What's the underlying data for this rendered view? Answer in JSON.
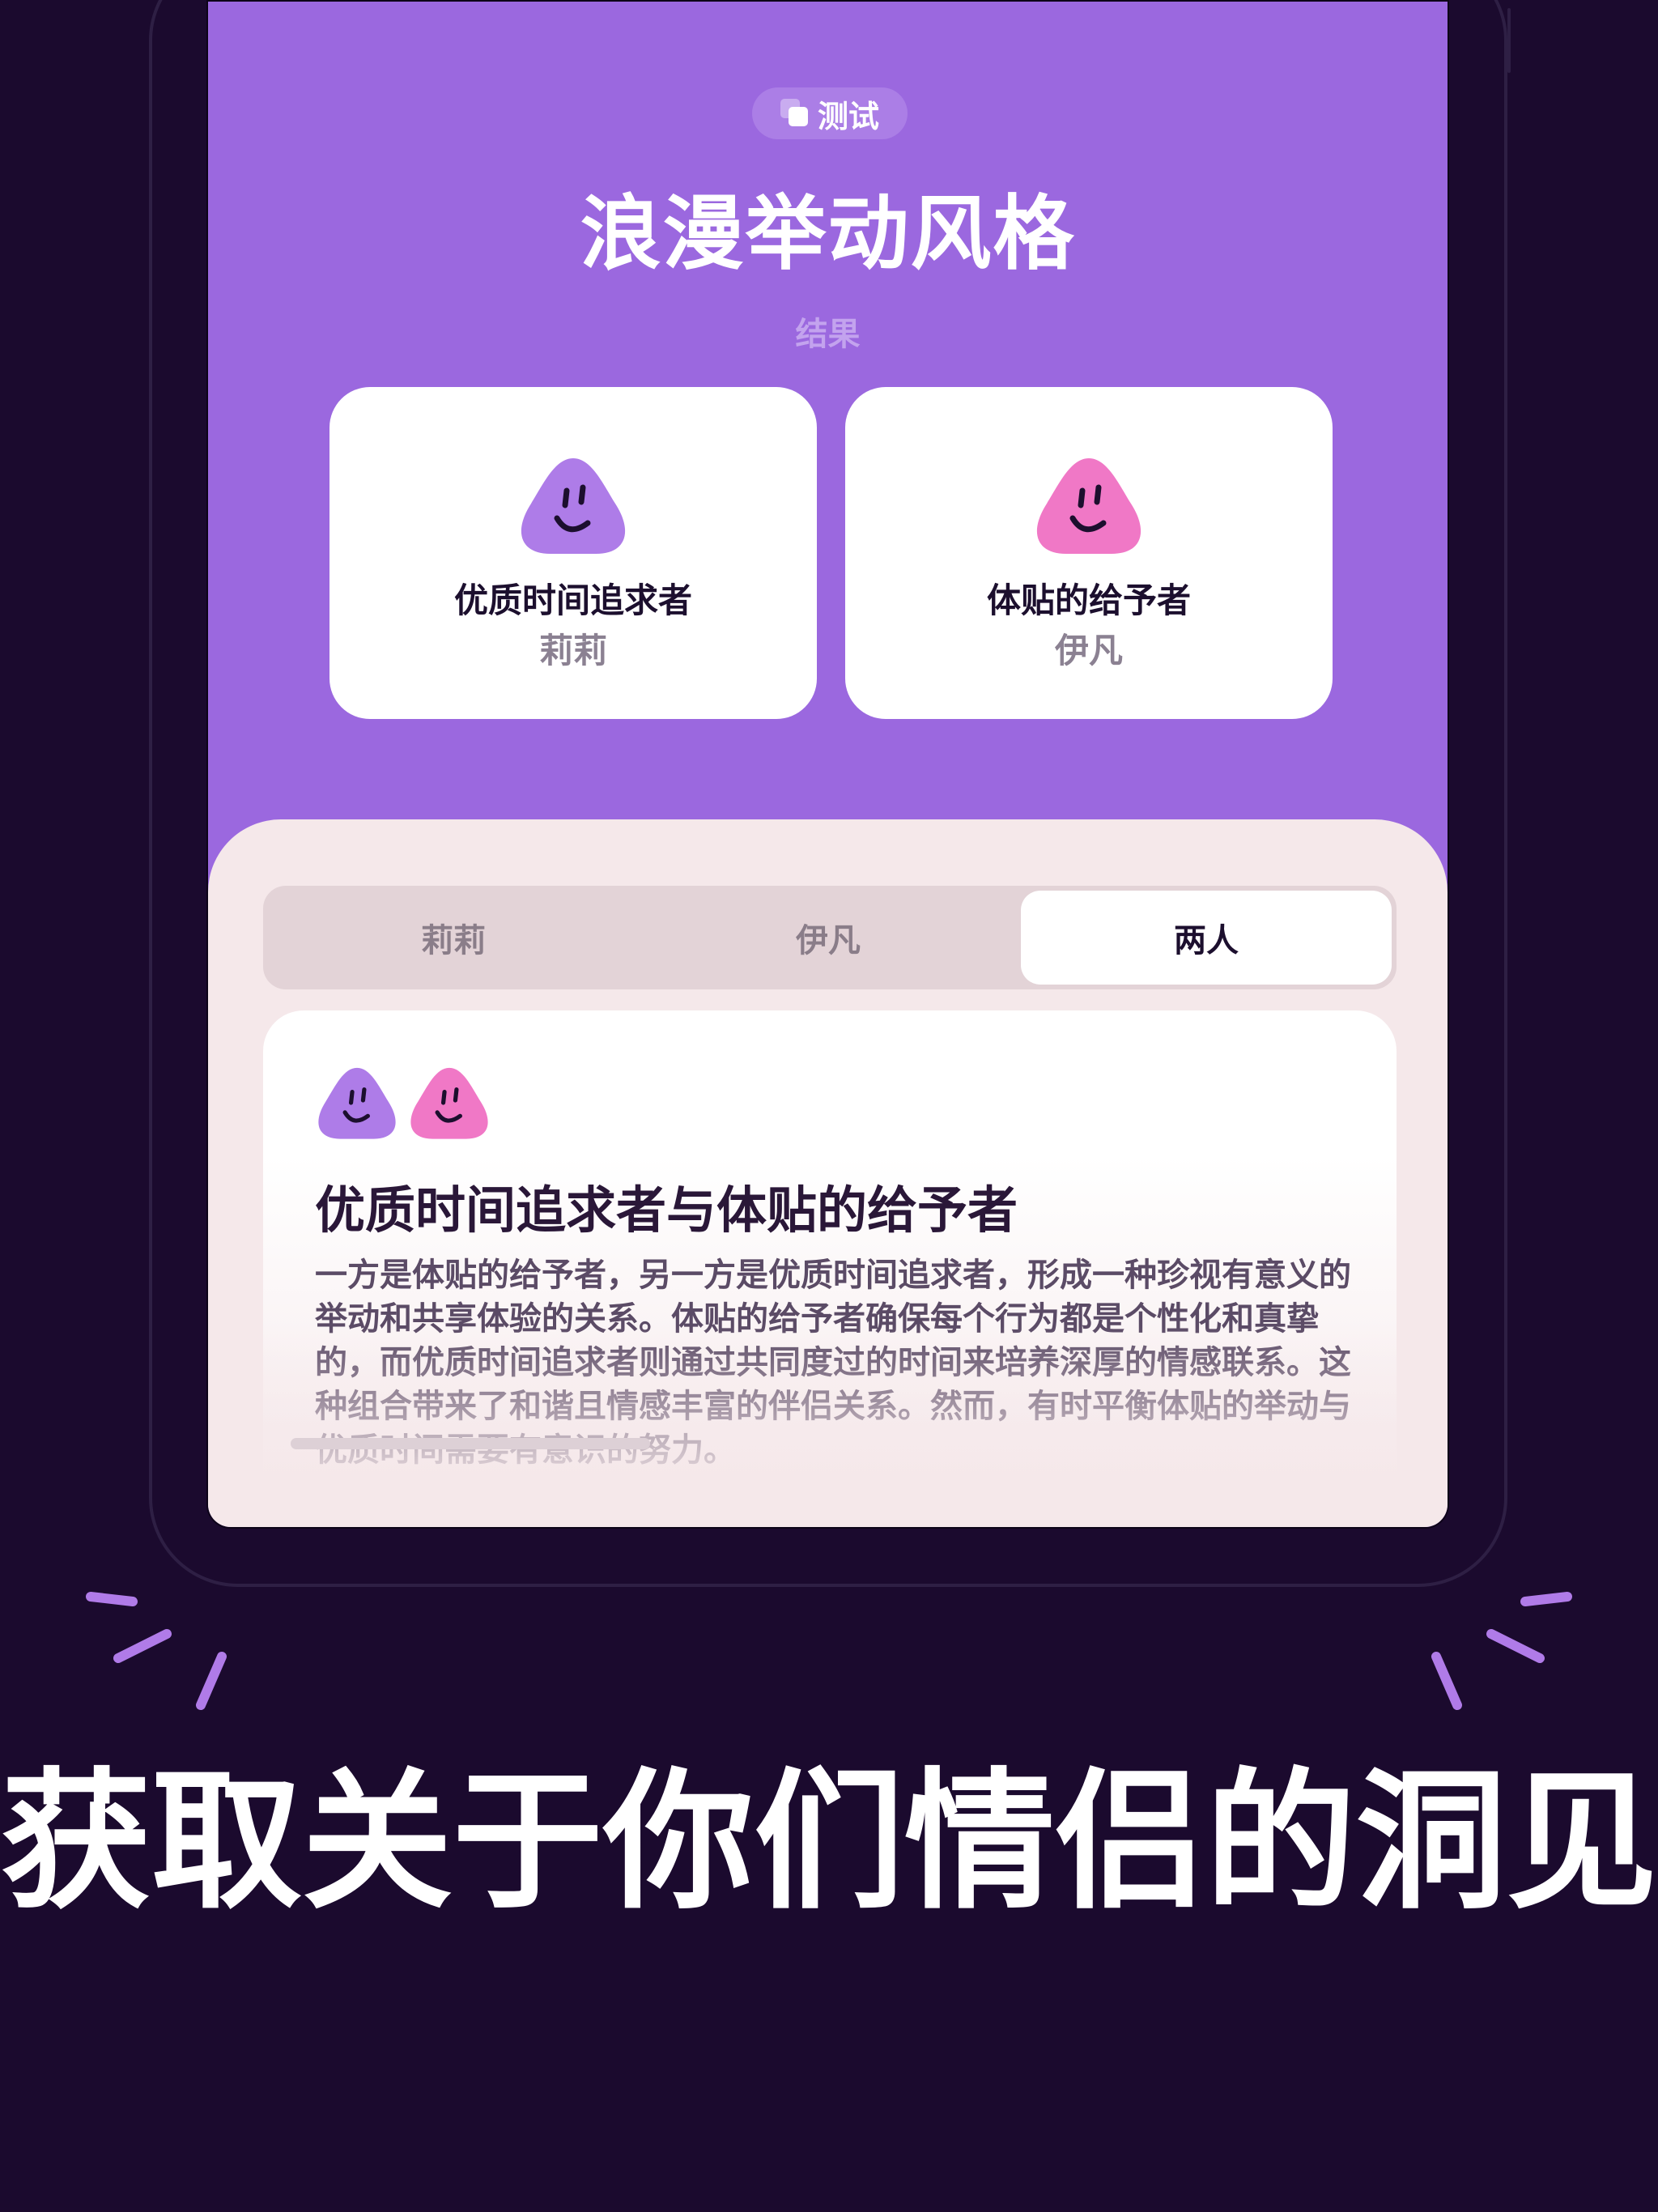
{
  "screen": {
    "badge_label": "测试",
    "title": "浪漫举动风格",
    "subtitle": "结果",
    "profiles": [
      {
        "type": "优质时间追求者",
        "person": "莉莉",
        "color": "#ae7ce8"
      },
      {
        "type": "体贴的给予者",
        "person": "伊凡",
        "color": "#f078c6"
      }
    ],
    "tabs": [
      {
        "label": "莉莉",
        "selected": false
      },
      {
        "label": "伊凡",
        "selected": false
      },
      {
        "label": "两人",
        "selected": true
      }
    ],
    "result": {
      "title": "优质时间追求者与体贴的给予者",
      "text": "一方是体贴的给予者，另一方是优质时间追求者，形成一种珍视有意义的举动和共享体验的关系。体贴的给予者确保每个行为都是个性化和真挚的，而优质时间追求者则通过共同度过的时间来培养深厚的情感联系。这种组合带来了和谐且情感丰富的伴侣关系。然而，有时平衡体贴的举动与优质时间需要有意识的努力。"
    }
  },
  "headline": "获取关于你们情侣的洞见",
  "colors": {
    "background": "#1b0a2e",
    "screen_purple": "#9b68df",
    "sheet": "#f5e8ea",
    "sparkle": "#b07be8"
  }
}
